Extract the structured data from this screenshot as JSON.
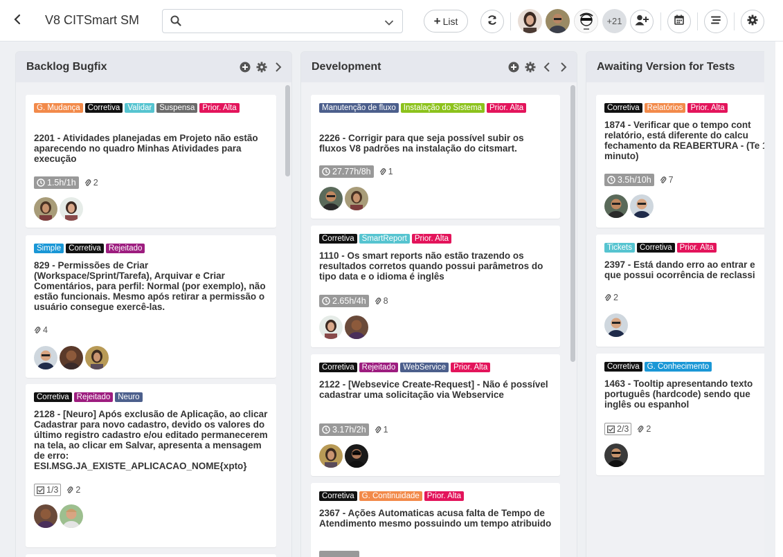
{
  "header": {
    "back_icon": "chevron-left-icon",
    "title": "V8 CITSmart SM",
    "search": {
      "placeholder": "",
      "value": ""
    },
    "list_button": "List",
    "more_users": "+21"
  },
  "colors": {
    "green": "#8cc21c",
    "black": "#111111",
    "teal": "#56c4d0",
    "gray": "#6b6b6b",
    "crimson": "#e3145b",
    "blue": "#1a97d6",
    "purple": "#9d1d7f",
    "slate": "#4c5f8c",
    "orange": "#f28a4a"
  },
  "columns": [
    {
      "title": "Backlog Bugfix",
      "cards": [
        {
          "tags": [
            {
              "label": "G. Mudança",
              "color": "#f28a4a"
            },
            {
              "label": "Corretiva",
              "color": "#111111"
            },
            {
              "label": "Validar",
              "color": "#56c4d0"
            },
            {
              "label": "Suspensa",
              "color": "#6b6b6b"
            },
            {
              "label": "Prior. Alta",
              "color": "#e3145b"
            }
          ],
          "title": "2201 - Atividades planejadas em Projeto não estão aparecendo no quadro Minhas Atividades para execução",
          "time": "1.5h/1h",
          "attachments": "2"
        },
        {
          "tags": [
            {
              "label": "Simple",
              "color": "#1a97d6"
            },
            {
              "label": "Corretiva",
              "color": "#111111"
            },
            {
              "label": "Rejeitado",
              "color": "#9d1d7f"
            }
          ],
          "title": "829 - Permissões de Criar (Workspace/Sprint/Tarefa), Arquivar e Criar Comentários, para perfil: Normal (por exemplo), não estão funcionais. Mesmo após retirar a permissão o usuário consegue exercê-las.",
          "attachments": "4"
        },
        {
          "tags": [
            {
              "label": "Corretiva",
              "color": "#111111"
            },
            {
              "label": "Rejeitado",
              "color": "#9d1d7f"
            },
            {
              "label": "Neuro",
              "color": "#4c5f8c"
            }
          ],
          "title": "2128 - [Neuro] Após exclusão de Aplicação, ao clicar Cadastrar para novo cadastro, devido os valores do último registro cadastro e/ou editado permanecerem na tela, ao clicar em Salvar, apresenta a mensagem de erro: ESI.MSG.JA_EXISTE_APLICACAO_NOME{xpto}",
          "checklist": "1/3",
          "attachments": "2"
        }
      ]
    },
    {
      "title": "Development",
      "cards": [
        {
          "tags": [
            {
              "label": "Manutenção de fluxo",
              "color": "#4c5f8c"
            },
            {
              "label": "Instalação do Sistema",
              "color": "#8cc21c"
            },
            {
              "label": "Prior. Alta",
              "color": "#e3145b"
            }
          ],
          "title": "2226 - Corrigir para que seja possível subir os fluxos V8 padrões na instalação do citsmart.",
          "time": "27.77h/8h",
          "attachments": "1"
        },
        {
          "tags": [
            {
              "label": "Corretiva",
              "color": "#111111"
            },
            {
              "label": "SmartReport",
              "color": "#56c4d0"
            },
            {
              "label": "Prior. Alta",
              "color": "#e3145b"
            }
          ],
          "title": "1110 - Os smart reports não estão trazendo os resultados corretos quando possui parâmetros do tipo data e o idioma é inglês",
          "time": "2.65h/4h",
          "attachments": "8"
        },
        {
          "tags": [
            {
              "label": "Corretiva",
              "color": "#111111"
            },
            {
              "label": "Rejeitado",
              "color": "#9d1d7f"
            },
            {
              "label": "WebService",
              "color": "#4c5f8c"
            },
            {
              "label": "Prior. Alta",
              "color": "#e3145b"
            }
          ],
          "title": "2122 - [Websevice Create-Request] - Não é possível cadastrar uma solicitação via Webservice",
          "time": "3.17h/2h",
          "attachments": "1"
        },
        {
          "tags": [
            {
              "label": "Corretiva",
              "color": "#111111"
            },
            {
              "label": "G. Continuidade",
              "color": "#f28a4a"
            },
            {
              "label": "Prior. Alta",
              "color": "#e3145b"
            }
          ],
          "title": "2367 - Ações Automaticas acusa falta de Tempo de Atendimento mesmo possuindo um tempo atribuido"
        }
      ]
    },
    {
      "title": "Awaiting Version for Tests",
      "cards": [
        {
          "tags": [
            {
              "label": "Corretiva",
              "color": "#111111"
            },
            {
              "label": "Relatórios",
              "color": "#f28a4a"
            },
            {
              "label": "Prior. Alta",
              "color": "#e3145b"
            }
          ],
          "title": "1874 - Verificar que o tempo cont relatório, está diferente do calcu fechamento da REABERTURA - (Te 1 minuto)",
          "time": "3.5h/10h",
          "attachments": "7"
        },
        {
          "tags": [
            {
              "label": "Tickets",
              "color": "#56c4d0"
            },
            {
              "label": "Corretiva",
              "color": "#111111"
            },
            {
              "label": "Prior. Alta",
              "color": "#e3145b"
            }
          ],
          "title": "2397 - Está dando erro ao entrar e que possui ocorrência de reclassi",
          "attachments": "2"
        },
        {
          "tags": [
            {
              "label": "Corretiva",
              "color": "#111111"
            },
            {
              "label": "G. Conhecimento",
              "color": "#1a97d6"
            }
          ],
          "title": "1463 - Tooltip apresentando texto português (hardcode) sendo que inglês ou espanhol",
          "checklist": "2/3",
          "attachments": "2"
        }
      ]
    }
  ]
}
